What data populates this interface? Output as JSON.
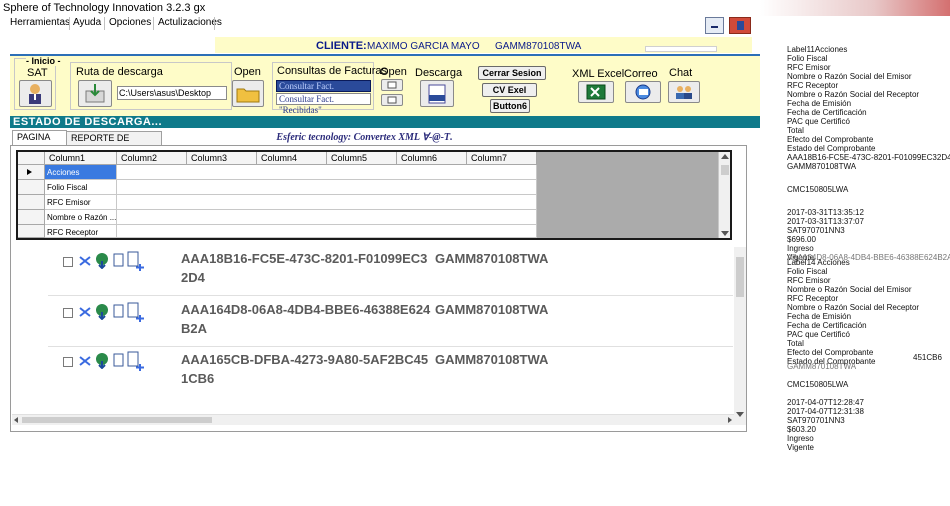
{
  "window": {
    "title": "Sphere of  Technology  Innovation  3.2.3 gx"
  },
  "menu": {
    "items": [
      "Herramientas",
      "Ayuda",
      "Opciones",
      "Actulizaciones"
    ]
  },
  "client": {
    "label": "CLIENTE:",
    "name": "MAXIMO GARCIA MAYO",
    "rfc": "GAMM870108TWA"
  },
  "toolbar": {
    "inicio_label": "- Inicio -",
    "sat_label": "SAT",
    "ruta_label": "Ruta de descarga",
    "ruta_value": "C:\\Users\\asus\\Desktop",
    "open1_label": "Open",
    "consultas_label": "Consultas de Facturas",
    "consultar_emitidas": "Consultar Fact. \"Emitidas\"",
    "consultar_recibidas": "Consultar Fact. \"Recibidas\"",
    "open2_label": "Open",
    "descarga_label": "Descarga",
    "cerrar_sesion": "Cerrar Sesion",
    "cv_exel": "CV  Exel",
    "button6": "Button6",
    "xml_excel_label": "XML Excel",
    "correo_label": "Correo",
    "chat_label": "Chat"
  },
  "section": {
    "title": "ESTADO DE DESCARGA..."
  },
  "tabs": [
    {
      "label": "PAGINA SAT"
    },
    {
      "label": "REPORTE DE DESCARGA"
    }
  ],
  "watermark": "Esferic tecnology: Convertex XML  ∀-@-Ƭ.",
  "grid": {
    "columns": [
      "Column1",
      "Column2",
      "Column3",
      "Column4",
      "Column5",
      "Column6",
      "Column7"
    ],
    "rows": [
      "Acciones",
      "Folio Fiscal",
      "RFC Emisor",
      "Nombre o Razón ...",
      "RFC Receptor"
    ]
  },
  "list": [
    {
      "uuid": "AAA18B16-FC5E-473C-8201-F01099EC32D4",
      "rfc": "GAMM870108TWA"
    },
    {
      "uuid": "AAA164D8-06A8-4DB4-BBE6-46388E624B2A",
      "rfc": "GAMM870108TWA"
    },
    {
      "uuid": "AAA165CB-DFBA-4273-9A80-5AF2BC451CB6",
      "rfc": "GAMM870108TWA"
    }
  ],
  "right_panel": {
    "block1": [
      "Label11Acciones",
      "Folio Fiscal",
      "RFC Emisor",
      "Nombre o Razón Social del Emisor",
      "RFC Receptor",
      "Nombre o Razón Social del Receptor",
      "Fecha de Emisión",
      "Fecha de Certificación",
      "PAC que Certificó",
      "Total",
      "Efecto del Comprobante",
      "Estado del Comprobante",
      "AAA18B16-FC5E-473C-8201-F01099EC32D4",
      "GAMM870108TWA",
      "",
      "CMC150805LWA",
      "",
      "2017-03-31T13:35:12",
      "2017-03-31T13:37:07",
      "SAT970701NN3",
      "$696.00",
      "Ingreso",
      "Vigente"
    ],
    "overlap1": "AAA164D8-06A8-4DB4-BBE6-46388E624B2A",
    "block2": [
      "Label14  Acciones",
      "Folio Fiscal",
      "RFC Emisor",
      "Nombre o Razón Social del Emisor",
      "RFC Receptor",
      "Nombre o Razón Social del Receptor",
      "Fecha de Emisión",
      "Fecha de Certificación",
      "PAC que Certificó",
      "Total",
      "Efecto del Comprobante",
      "Estado del Comprobante"
    ],
    "overlap2": "GAMM870108TWA",
    "side_code": "451CB6",
    "block3": [
      "CMC150805LWA",
      "",
      "2017-04-07T12:28:47",
      "2017-04-07T12:31:38",
      "SAT970701NN3",
      "$603.20",
      "Ingreso",
      "Vigente"
    ]
  }
}
